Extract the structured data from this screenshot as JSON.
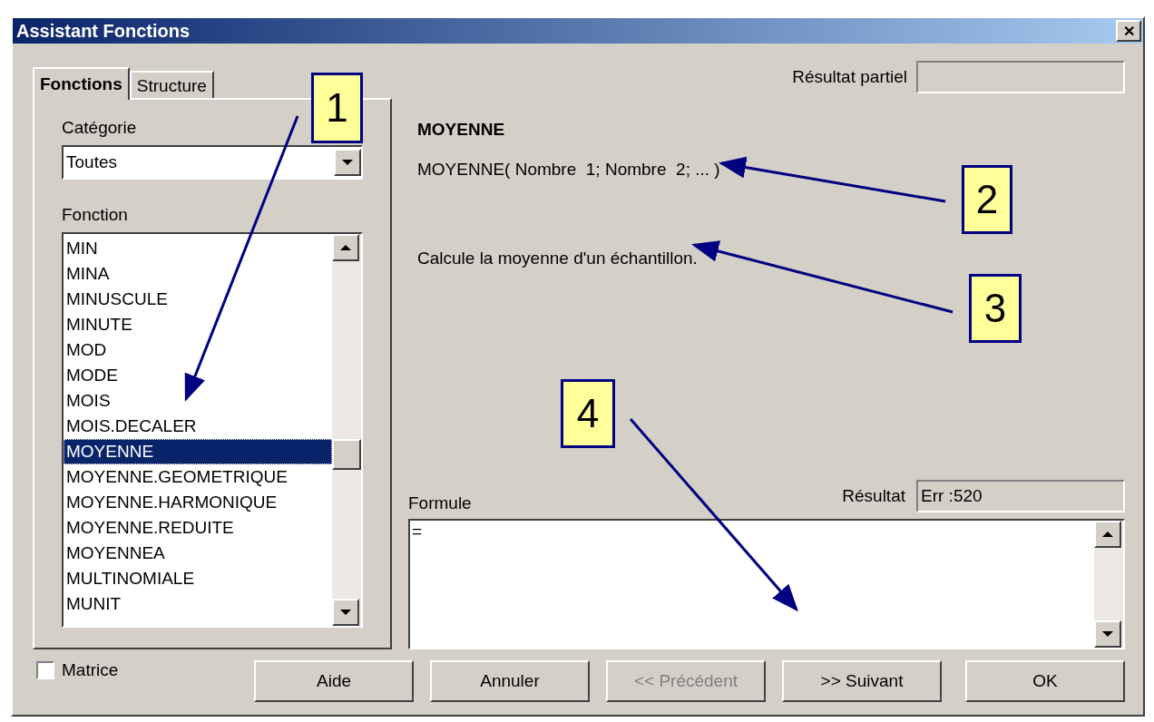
{
  "window": {
    "title": "Assistant Fonctions",
    "close": "✕"
  },
  "tabs": [
    {
      "label": "Fonctions",
      "selected": true
    },
    {
      "label": "Structure",
      "selected": false
    }
  ],
  "category": {
    "label": "Catégorie",
    "value": "Toutes"
  },
  "functions": {
    "label": "Fonction",
    "items": [
      {
        "name": "MIN",
        "selected": false
      },
      {
        "name": "MINA",
        "selected": false
      },
      {
        "name": "MINUSCULE",
        "selected": false
      },
      {
        "name": "MINUTE",
        "selected": false
      },
      {
        "name": "MOD",
        "selected": false
      },
      {
        "name": "MODE",
        "selected": false
      },
      {
        "name": "MOIS",
        "selected": false
      },
      {
        "name": "MOIS.DECALER",
        "selected": false
      },
      {
        "name": "MOYENNE",
        "selected": true
      },
      {
        "name": "MOYENNE.GEOMETRIQUE",
        "selected": false
      },
      {
        "name": "MOYENNE.HARMONIQUE",
        "selected": false
      },
      {
        "name": "MOYENNE.REDUITE",
        "selected": false
      },
      {
        "name": "MOYENNEA",
        "selected": false
      },
      {
        "name": "MULTINOMIALE",
        "selected": false
      },
      {
        "name": "MUNIT",
        "selected": false
      }
    ]
  },
  "partial_result": {
    "label": "Résultat partiel"
  },
  "function_name": "MOYENNE",
  "syntax": "MOYENNE( Nombre  1; Nombre  2; ... )",
  "description": "Calcule la moyenne d'un échantillon.",
  "formula": {
    "label": "Formule",
    "value": "="
  },
  "result": {
    "label": "Résultat",
    "value": "Err :520"
  },
  "matrix": {
    "label": "Matrice",
    "checked": false
  },
  "buttons": [
    {
      "label": "Aide",
      "disabled": false
    },
    {
      "label": "Annuler",
      "disabled": false
    },
    {
      "label": "<< Précédent",
      "disabled": true
    },
    {
      "label": ">> Suivant",
      "disabled": false
    },
    {
      "label": "OK",
      "disabled": false
    }
  ],
  "callouts": [
    {
      "label": "1"
    },
    {
      "label": "2"
    },
    {
      "label": "3"
    },
    {
      "label": "4"
    }
  ]
}
